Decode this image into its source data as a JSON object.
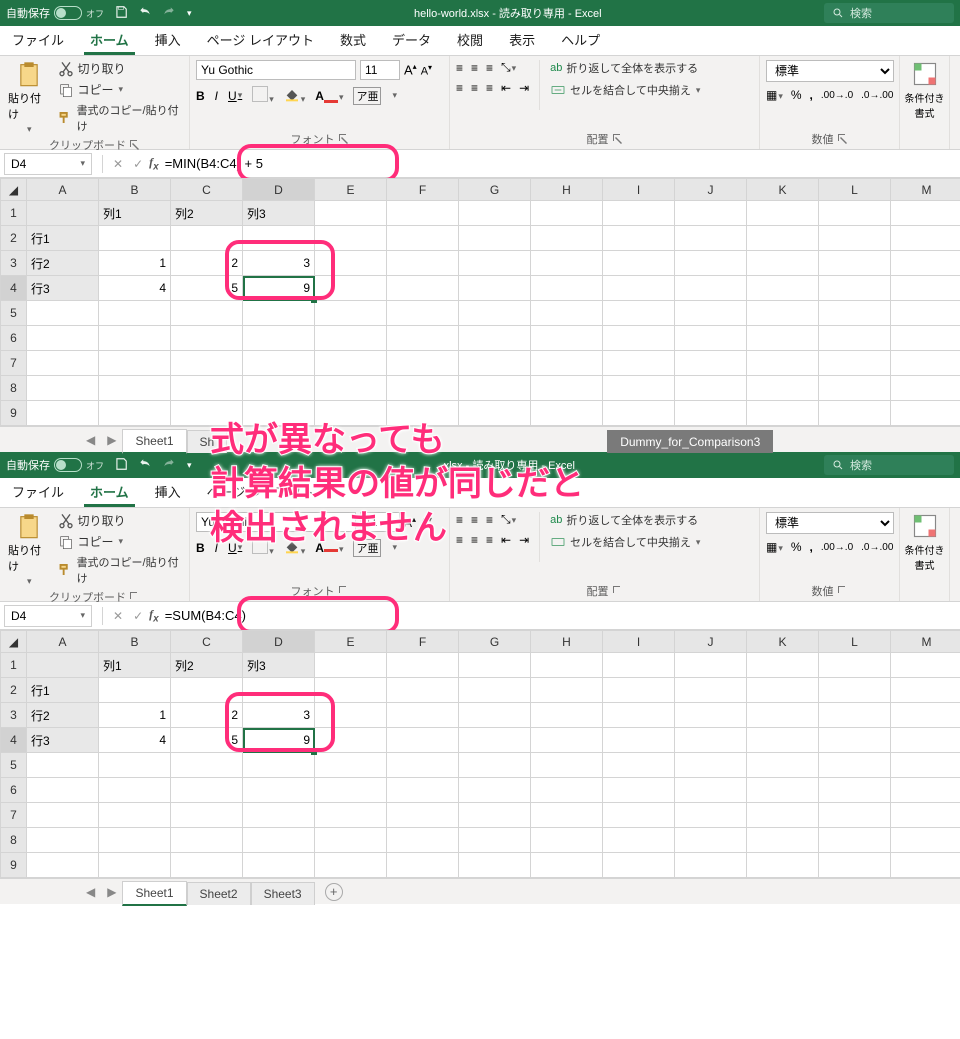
{
  "titlebar": {
    "autosave_label": "自動保存",
    "autosave_state": "オフ",
    "title_top": "hello-world.xlsx  -  読み取り専用  -  Excel",
    "title_bottom": ".xlsx  -  読み取り専用  -  Excel",
    "search_placeholder": "検索"
  },
  "menu": {
    "items": [
      "ファイル",
      "ホーム",
      "挿入",
      "ページ レイアウト",
      "数式",
      "データ",
      "校閲",
      "表示",
      "ヘルプ"
    ],
    "active_index": 1
  },
  "ribbon": {
    "clipboard": {
      "label": "クリップボード",
      "paste": "貼り付け",
      "cut": "切り取り",
      "copy": "コピー",
      "fmtpaint": "書式のコピー/貼り付け"
    },
    "font": {
      "label": "フォント",
      "name": "Yu Gothic",
      "size": "11"
    },
    "alignment": {
      "label": "配置",
      "wrap": "折り返して全体を表示する",
      "merge": "セルを結合して中央揃え"
    },
    "number": {
      "label": "数値",
      "format": "標準"
    },
    "cond": {
      "label": "条件付き\n書式"
    }
  },
  "fx": {
    "namebox": "D4",
    "formula_top": "=MIN(B4:C4) + 5",
    "formula_bottom": "=SUM(B4:C4)"
  },
  "columns": [
    "A",
    "B",
    "C",
    "D",
    "E",
    "F",
    "G",
    "H",
    "I",
    "J",
    "K",
    "L",
    "M"
  ],
  "cells": {
    "headers": {
      "B1": "列1",
      "C1": "列2",
      "D1": "列3"
    },
    "rows": {
      "A2": "行1",
      "A3": "行2",
      "A4": "行3"
    },
    "data": {
      "B3": "1",
      "C3": "2",
      "D3": "3",
      "B4": "4",
      "C4": "5",
      "D4": "9"
    }
  },
  "sheets_top": [
    "Sheet1",
    "Sh",
    "",
    "",
    "Dummy_for_Comparison3"
  ],
  "sheets_bottom": [
    "Sheet1",
    "Sheet2",
    "Sheet3"
  ],
  "annotation": "式が異なっても\n計算結果の値が同じだと\n検出されません"
}
